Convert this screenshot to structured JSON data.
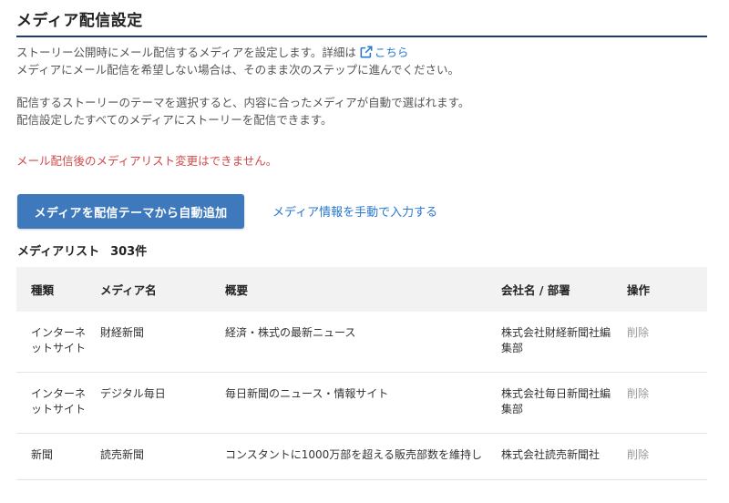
{
  "page": {
    "title": "メディア配信設定",
    "desc_line1_prefix": "ストーリー公開時にメール配信するメディアを設定します。詳細は",
    "desc_link": "こちら",
    "desc_line2": "メディアにメール配信を希望しない場合は、そのまま次のステップに進んでください。",
    "desc_line3": "配信するストーリーのテーマを選択すると、内容に合ったメディアが自動で選ばれます。",
    "desc_line4": "配信設定したすべてのメディアにストーリーを配信できます。",
    "warning": "メール配信後のメディアリスト変更はできません。",
    "warning_color": "#d14a4a"
  },
  "actions": {
    "auto_add_button": "メディアを配信テーマから自動追加",
    "manual_input_link": "メディア情報を手動で入力する",
    "accent_color": "#3e79be"
  },
  "media_list": {
    "label": "メディアリスト",
    "count": "303件",
    "columns": {
      "type": "種類",
      "name": "メディア名",
      "summary": "概要",
      "company": "会社名 / 部署",
      "action": "操作"
    },
    "rows": [
      {
        "type": "インターネットサイト",
        "name": "財経新聞",
        "summary": "経済・株式の最新ニュース",
        "company": "株式会社財経新聞社編集部",
        "action": "削除"
      },
      {
        "type": "インターネットサイト",
        "name": "デジタル毎日",
        "summary": "毎日新聞のニュース・情報サイト",
        "company": "株式会社毎日新聞社編集部",
        "action": "削除"
      },
      {
        "type": "新聞",
        "name": "読売新聞",
        "summary": "コンスタントに1000万部を超える販売部数を維持し",
        "company": "株式会社読売新聞社",
        "action": "削除"
      }
    ]
  },
  "icons": {
    "external_link": "external-link-icon"
  }
}
